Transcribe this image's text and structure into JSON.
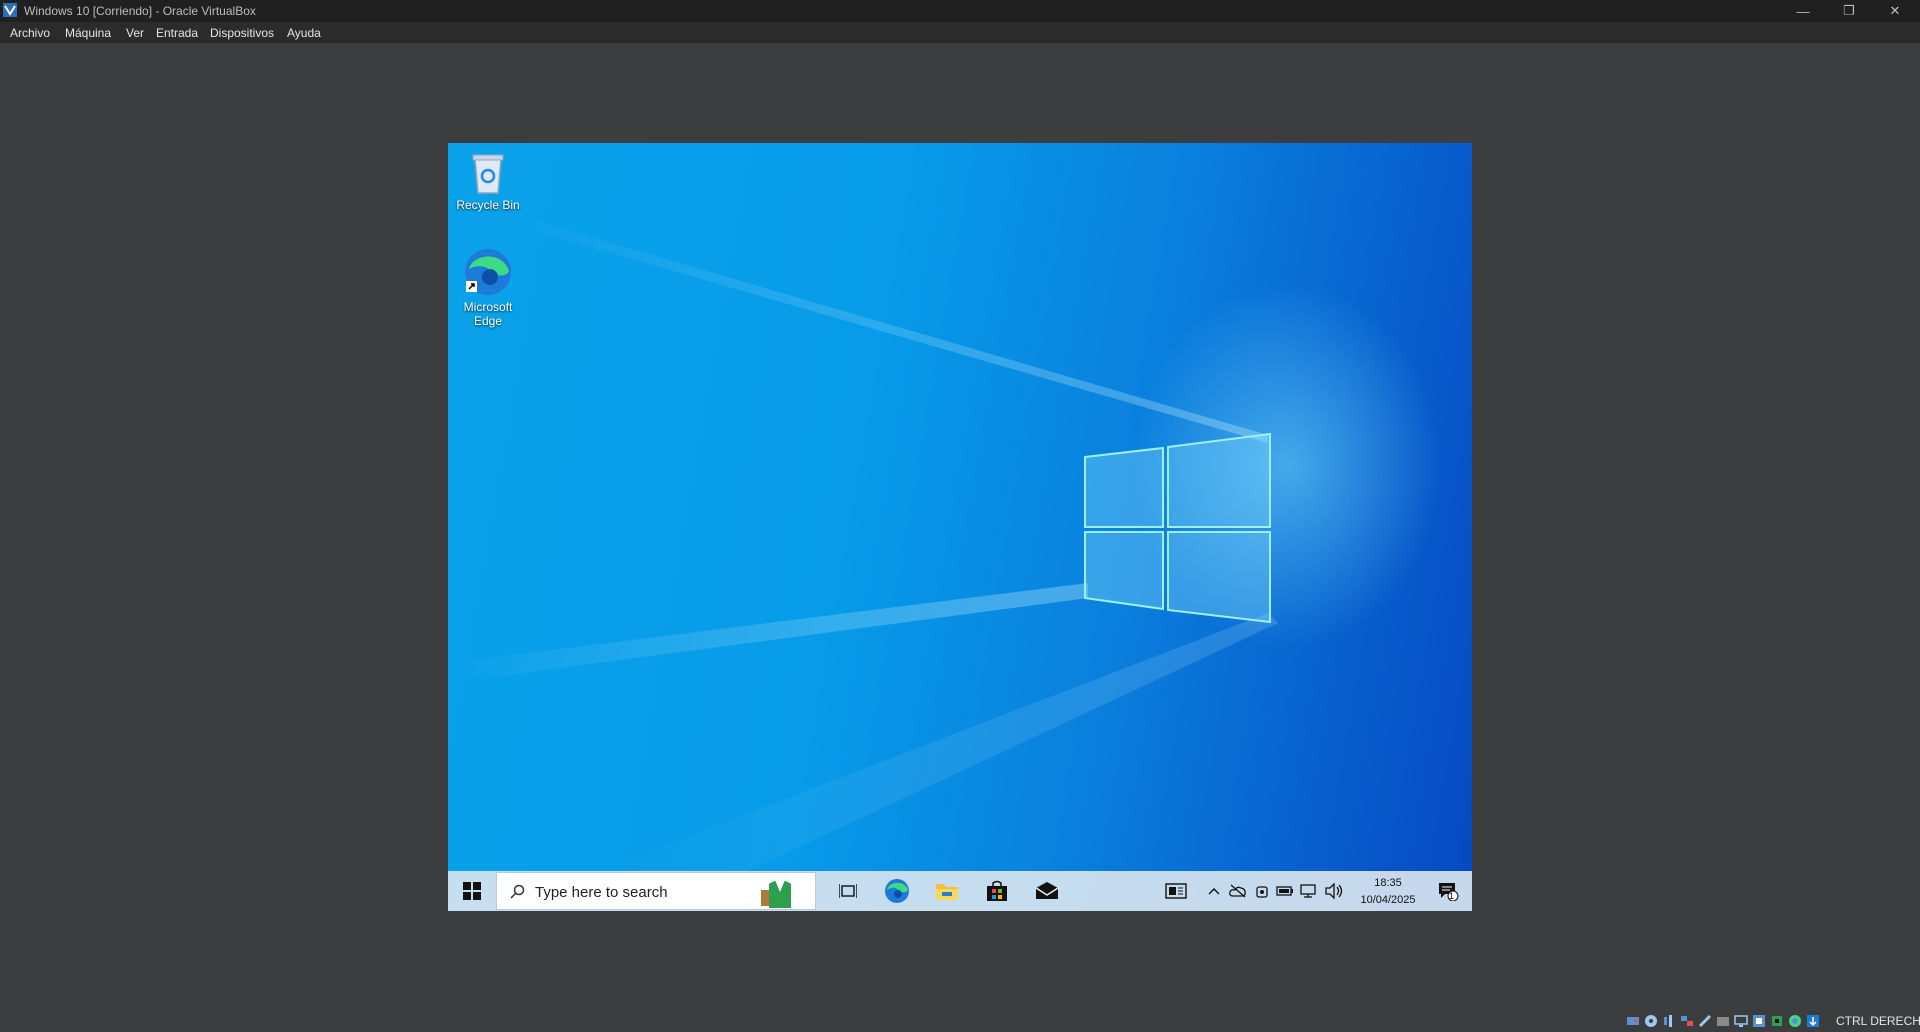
{
  "window": {
    "title": "Windows 10  [Corriendo] - Oracle VirtualBox",
    "minimize_glyph": "—",
    "maximize_glyph": "❐",
    "close_glyph": "✕"
  },
  "menu": {
    "items": [
      "Archivo",
      "Máquina",
      "Ver",
      "Entrada",
      "Dispositivos",
      "Ayuda"
    ]
  },
  "desktop": {
    "icons": [
      {
        "label": "Recycle Bin",
        "icon": "recycle-bin-icon"
      },
      {
        "label_line1": "Microsoft",
        "label_line2": "Edge",
        "icon": "edge-icon"
      }
    ]
  },
  "taskbar": {
    "search_placeholder": "Type here to search",
    "time": "18:35",
    "date": "10/04/2025",
    "notification_count": "1",
    "pinned": [
      "task-view-icon",
      "edge-icon",
      "file-explorer-icon",
      "store-icon",
      "mail-icon"
    ],
    "tray": [
      "news-icon",
      "chevron-up-icon",
      "onedrive-icon",
      "meet-now-icon",
      "battery-icon",
      "network-icon",
      "volume-icon"
    ]
  },
  "statusbar": {
    "host_key": "CTRL DERECHA"
  },
  "colors": {
    "title_bg": "#202020",
    "menu_bg": "#2b2b2b",
    "host_bg": "#3c3d3f",
    "desktop_blue": "#0a7fdd",
    "taskbar_bg": "#d7e4f0"
  }
}
